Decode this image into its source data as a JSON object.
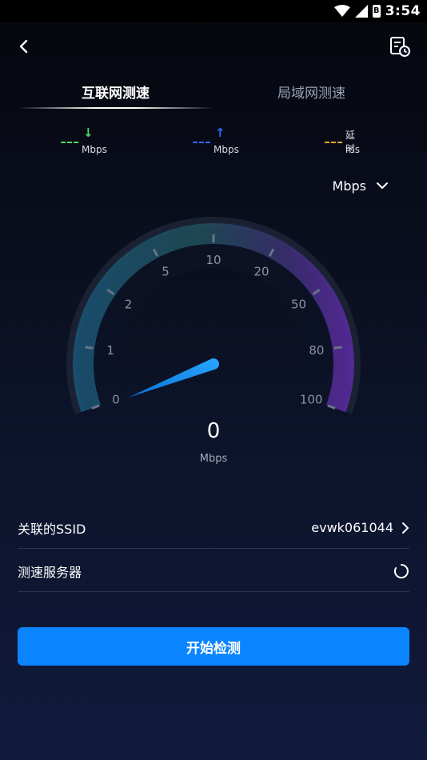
{
  "status_bar": {
    "time": "3:54",
    "battery_glyph": "B"
  },
  "tabs": [
    {
      "label": "互联网测速",
      "active": true
    },
    {
      "label": "局域网测速",
      "active": false
    }
  ],
  "legend": {
    "download": {
      "value": "---",
      "arrow": "↓",
      "unit": "Mbps",
      "color": "#4cd964"
    },
    "upload": {
      "value": "---",
      "arrow": "↑",
      "unit": "Mbps",
      "color": "#2f6bff"
    },
    "latency": {
      "value": "---",
      "label": "延时",
      "unit": "ms",
      "color": "#f5a623"
    }
  },
  "unit_selector": {
    "value": "Mbps"
  },
  "gauge": {
    "ticks": [
      "0",
      "1",
      "2",
      "5",
      "10",
      "20",
      "50",
      "80",
      "100"
    ],
    "needle_value": 0,
    "colors": {
      "track": "#1a2133",
      "left": "#1a5a7a",
      "top": "#1e4c5c",
      "right": "#5a2fa0"
    }
  },
  "speed": {
    "value": "0",
    "unit": "Mbps"
  },
  "rows": {
    "ssid": {
      "label": "关联的SSID",
      "value": "evwk061044"
    },
    "server": {
      "label": "测速服务器"
    }
  },
  "start_button": {
    "label": "开始检测"
  }
}
